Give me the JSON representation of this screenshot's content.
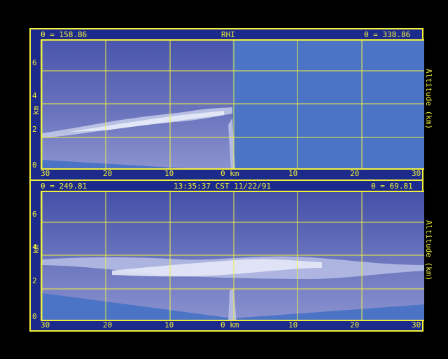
{
  "colors": {
    "frame_bg": "#1c2a8c",
    "accent": "#f1f03a",
    "sky_blue": "#4c74c6",
    "echo_light": "#c4cdea",
    "echo_mid": "#8f99d2",
    "background": "#000000"
  },
  "top_panel": {
    "title": "RHI",
    "left_angle": "θ = 158.86",
    "right_angle": "θ = 338.86",
    "y_axis_label": "km",
    "right_axis_label": "Altitude (km)",
    "y_ticks": [
      "6",
      "4",
      "2",
      "0"
    ],
    "x_ticks": [
      "30",
      "20",
      "10",
      "0 km",
      "10",
      "20",
      "30"
    ]
  },
  "bottom_panel": {
    "timestamp": "13:35:37 CST 11/22/91",
    "left_angle": "θ = 249.81",
    "right_angle": "θ = 69.81",
    "y_axis_label": "km",
    "right_axis_label": "Altitude (km)",
    "y_ticks": [
      "6",
      "4",
      "2",
      "0"
    ],
    "x_ticks": [
      "30",
      "20",
      "10",
      "0 km",
      "10",
      "20",
      "30"
    ]
  }
}
